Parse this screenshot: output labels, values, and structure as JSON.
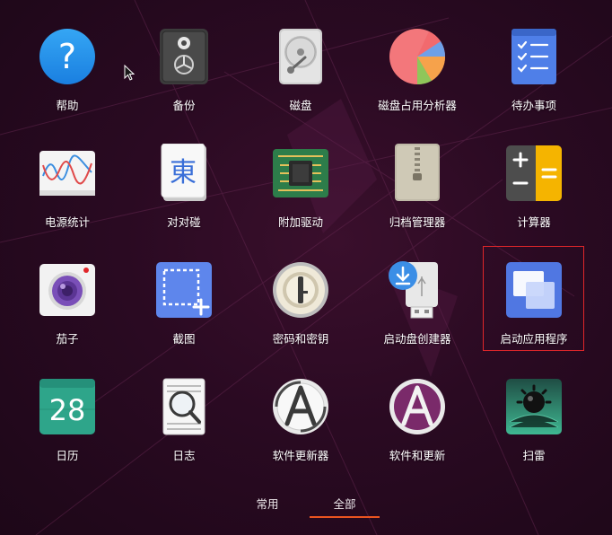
{
  "apps": [
    {
      "label": "帮助",
      "icon": "help-icon"
    },
    {
      "label": "备份",
      "icon": "backup-safe-icon"
    },
    {
      "label": "磁盘",
      "icon": "disk-drive-icon"
    },
    {
      "label": "磁盘占用分析器",
      "icon": "pie-chart-icon"
    },
    {
      "label": "待办事项",
      "icon": "todo-list-icon"
    },
    {
      "label": "电源统计",
      "icon": "power-graph-icon"
    },
    {
      "label": "对对碰",
      "icon": "mahjong-tile-icon"
    },
    {
      "label": "附加驱动",
      "icon": "chip-icon"
    },
    {
      "label": "归档管理器",
      "icon": "archive-zipper-icon"
    },
    {
      "label": "计算器",
      "icon": "calculator-icon"
    },
    {
      "label": "茄子",
      "icon": "camera-icon"
    },
    {
      "label": "截图",
      "icon": "screenshot-icon"
    },
    {
      "label": "密码和密钥",
      "icon": "keyring-icon"
    },
    {
      "label": "启动盘创建器",
      "icon": "usb-drive-icon"
    },
    {
      "label": "启动应用程序",
      "icon": "startup-windows-icon"
    },
    {
      "label": "日历",
      "icon": "calendar-icon",
      "day": "28"
    },
    {
      "label": "日志",
      "icon": "logs-magnifier-icon"
    },
    {
      "label": "软件更新器",
      "icon": "software-updater-icon"
    },
    {
      "label": "软件和更新",
      "icon": "software-sources-icon"
    },
    {
      "label": "扫雷",
      "icon": "mines-icon"
    }
  ],
  "tabs": [
    {
      "label": "常用",
      "active": false
    },
    {
      "label": "全部",
      "active": true
    }
  ],
  "calendar": {
    "day": "28"
  },
  "mahjong": {
    "glyph": "東"
  },
  "colors": {
    "tab_underline": "#e95420",
    "selection": "#e0262a",
    "background": "#2a0a22"
  }
}
